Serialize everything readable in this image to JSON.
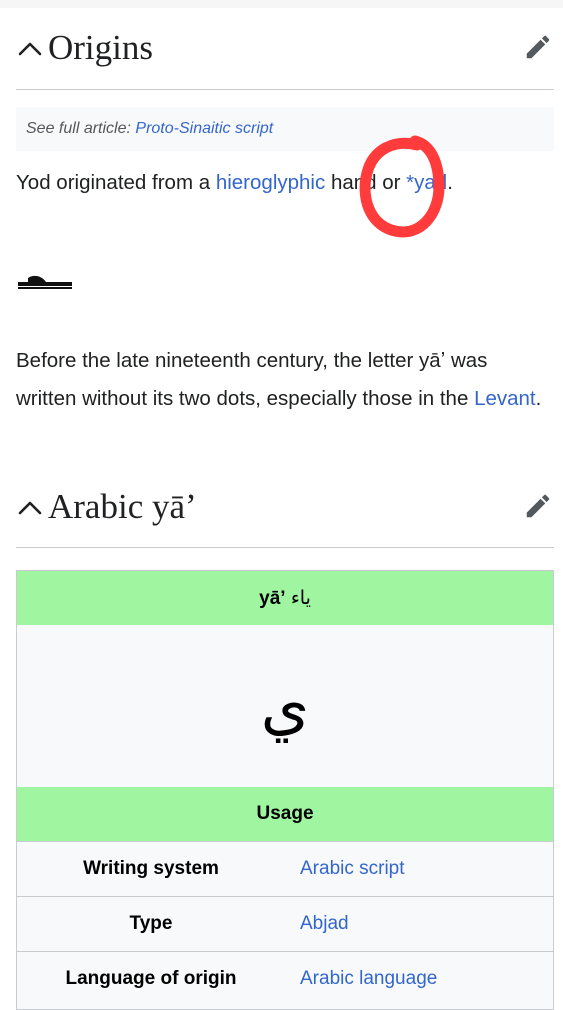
{
  "section1": {
    "title": "Origins"
  },
  "hatnote": {
    "prefix": "See full article: ",
    "link": "Proto-Sinaitic script"
  },
  "para1": {
    "t1": "Yod originated from a ",
    "link1": "hieroglyphic",
    "t2": " ",
    "link2": "hand",
    "t3": " or ",
    "link3": "*yad",
    "t4": "."
  },
  "para2": {
    "text": "Before the late nineteenth century, the letter yāʼ was written without its two dots, especially those in the ",
    "link": "Levant",
    "end": "."
  },
  "section2": {
    "title": "Arabic yāʼ"
  },
  "infobox": {
    "header_latin": "yāʼ",
    "header_arabic": "ياء",
    "letter": "ي",
    "usage_header": "Usage",
    "rows": [
      {
        "label": "Writing system",
        "value": "Arabic script"
      },
      {
        "label": "Type",
        "value": "Abjad"
      },
      {
        "label": "Language of origin",
        "value": "Arabic language"
      }
    ]
  },
  "colors": {
    "link": "#3366cc",
    "infobox_header": "#a0f5a0",
    "annotation": "#ff3b3b"
  }
}
